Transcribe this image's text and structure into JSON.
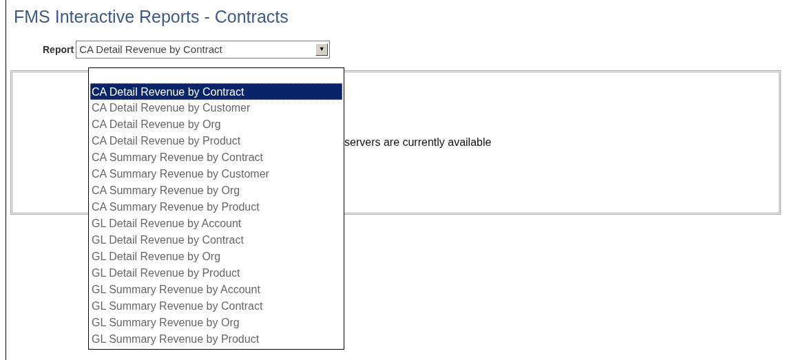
{
  "title": "FMS Interactive Reports - Contracts",
  "report": {
    "label": "Report",
    "value": "CA Detail Revenue by Contract",
    "arrow": "▼",
    "expanded": true
  },
  "options": [
    {
      "label": "CA Detail Revenue by Contract",
      "selected": true
    },
    {
      "label": "CA Detail Revenue by Customer",
      "selected": false
    },
    {
      "label": "CA Detail Revenue by Org",
      "selected": false
    },
    {
      "label": "CA Detail Revenue by Product",
      "selected": false
    },
    {
      "label": "CA Summary Revenue by Contract",
      "selected": false
    },
    {
      "label": "CA Summary Revenue by Customer",
      "selected": false
    },
    {
      "label": "CA Summary Revenue by Org",
      "selected": false
    },
    {
      "label": "CA Summary Revenue by Product",
      "selected": false
    },
    {
      "label": "GL Detail Revenue by Account",
      "selected": false
    },
    {
      "label": "GL Detail Revenue by Contract",
      "selected": false
    },
    {
      "label": "GL Detail Revenue by Org",
      "selected": false
    },
    {
      "label": "GL Detail Revenue by Product",
      "selected": false
    },
    {
      "label": "GL Summary Revenue by Account",
      "selected": false
    },
    {
      "label": "GL Summary Revenue by Contract",
      "selected": false
    },
    {
      "label": "GL Summary Revenue by Org",
      "selected": false
    },
    {
      "label": "GL Summary Revenue by Product",
      "selected": false
    }
  ],
  "panel": {
    "message": "servers are currently available"
  }
}
